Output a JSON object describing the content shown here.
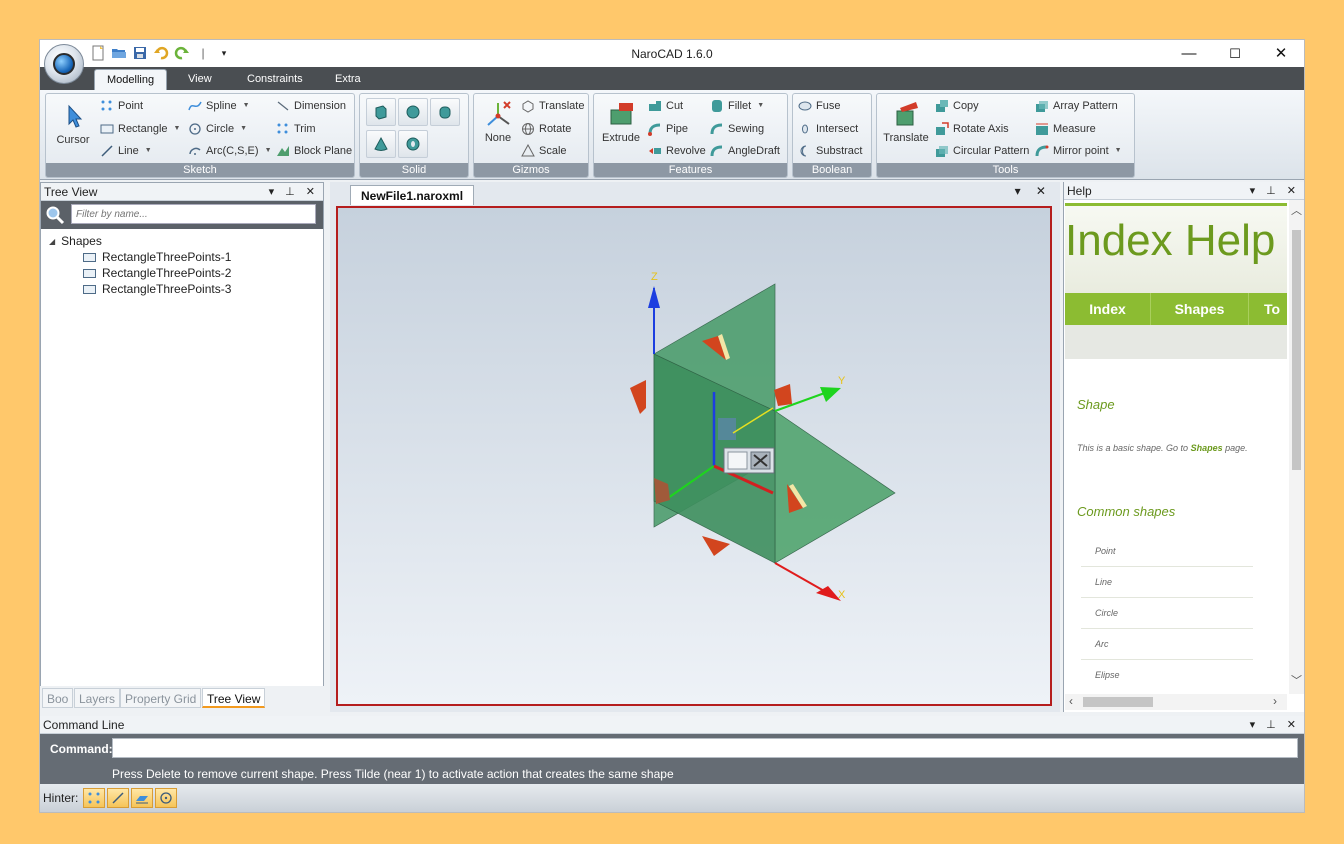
{
  "window": {
    "title": "NaroCAD 1.6.0",
    "minimize": "—",
    "maximize": "☐",
    "close": "✕"
  },
  "quick_access": [
    "new-icon",
    "open-icon",
    "save-icon",
    "undo-icon",
    "redo-icon",
    "customize-icon"
  ],
  "ribbon_tabs": [
    {
      "label": "Modelling",
      "active": true
    },
    {
      "label": "View",
      "active": false
    },
    {
      "label": "Constraints",
      "active": false
    },
    {
      "label": "Extra",
      "active": false
    }
  ],
  "ribbon": {
    "sketch": {
      "name": "Sketch",
      "cursor": "Cursor",
      "point": "Point",
      "rectangle": "Rectangle",
      "line": "Line",
      "spline": "Spline",
      "circle": "Circle",
      "arc": "Arc(C,S,E)",
      "dimension": "Dimension",
      "trim": "Trim",
      "block_plane": "Block Plane"
    },
    "solid": {
      "name": "Solid"
    },
    "gizmos": {
      "name": "Gizmos",
      "none": "None",
      "translate": "Translate",
      "rotate": "Rotate",
      "scale": "Scale"
    },
    "features": {
      "name": "Features",
      "extrude": "Extrude",
      "cut": "Cut",
      "pipe": "Pipe",
      "revolve": "Revolve",
      "fillet": "Fillet",
      "sewing": "Sewing",
      "angle_draft": "AngleDraft"
    },
    "boolean": {
      "name": "Boolean",
      "fuse": "Fuse",
      "intersect": "Intersect",
      "substract": "Substract"
    },
    "tools": {
      "name": "Tools",
      "translate": "Translate",
      "copy": "Copy",
      "rotate_axis": "Rotate Axis",
      "circular_pattern": "Circular Pattern",
      "array_pattern": "Array Pattern",
      "measure": "Measure",
      "mirror_point": "Mirror point"
    }
  },
  "tree_view": {
    "title": "Tree View",
    "panel_tools": "▾ ⊥ ✕",
    "search_placeholder": "Filter by name...",
    "root": "Shapes",
    "items": [
      "RectangleThreePoints-1",
      "RectangleThreePoints-2",
      "RectangleThreePoints-3"
    ],
    "bottom_tabs": [
      {
        "label": "Boo",
        "active": false
      },
      {
        "label": "Layers",
        "active": false
      },
      {
        "label": "Property Grid",
        "active": false
      },
      {
        "label": "Tree View",
        "active": true
      }
    ]
  },
  "document": {
    "tab": "NewFile1.naroxml",
    "tools": "▾ ✕",
    "axes": {
      "z": "Z",
      "y": "Y",
      "x": "X"
    }
  },
  "help": {
    "title": "Help",
    "heading": "Index Help",
    "nav": [
      "Index",
      "Shapes",
      "To"
    ],
    "section1": "Shape",
    "body_prefix": "This is a basic shape. Go to ",
    "body_link": "Shapes",
    "body_suffix": " page.",
    "section2": "Common shapes",
    "list": [
      "Point",
      "Line",
      "Circle",
      "Arc",
      "Elipse"
    ]
  },
  "command_line": {
    "title": "Command Line",
    "label": "Command:",
    "value": "",
    "hint": "Press Delete to remove current shape. Press Tilde (near 1) to activate action that creates the same shape"
  },
  "hinter": {
    "label": "Hinter:",
    "buttons": [
      "point-snap-icon",
      "line-snap-icon",
      "plane-snap-icon",
      "circle-snap-icon"
    ]
  },
  "colors": {
    "accent_green": "#8CBC32",
    "viewport_border": "#B51D1D",
    "shape_fill": "#4E9E6E"
  }
}
